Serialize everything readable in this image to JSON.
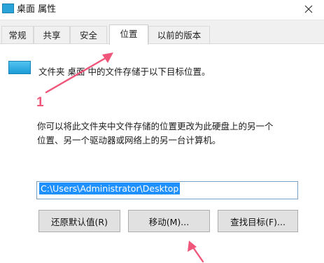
{
  "window": {
    "title": "桌面 属性",
    "close_icon": "close-icon"
  },
  "tabs": [
    {
      "label": "常规",
      "active": false
    },
    {
      "label": "共享",
      "active": false
    },
    {
      "label": "安全",
      "active": false
    },
    {
      "label": "位置",
      "active": true
    },
    {
      "label": "以前的版本",
      "active": false
    }
  ],
  "location": {
    "folder_icon": "folder-icon",
    "description": "文件夹 桌面 中的文件存储于以下目标位置。",
    "info_line1": "你可以将此文件夹中文件存储的位置更改为此硬盘上的另一个",
    "info_line2": "位置、另一个驱动器或网络上的另一台计算机。",
    "path_value": "C:\\Users\\Administrator\\Desktop"
  },
  "buttons": {
    "restore_default": "还原默认值(R)",
    "move": "移动(M)...",
    "find_target": "查找目标(F)..."
  },
  "annotations": {
    "step_number": "1",
    "arrow_color": "#f0567a"
  }
}
